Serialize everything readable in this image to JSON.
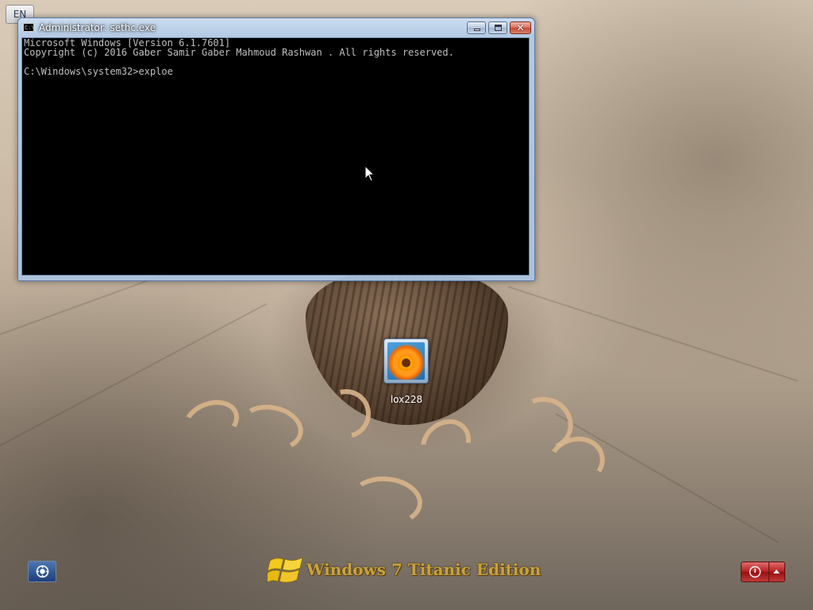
{
  "language_indicator": {
    "label": "EN"
  },
  "console_window": {
    "title": "Administrator: sethc.exe",
    "lines": [
      "Microsoft Windows [Version 6.1.7601]",
      "Copyright (c) 2016 Gaber Samir Gaber Mahmoud Rashwan . All rights reserved.",
      "",
      "C:\\Windows\\system32>exploe"
    ],
    "close_glyph": "✕"
  },
  "user": {
    "name": "lox228"
  },
  "branding": {
    "text": "Windows 7 Titanic Edition"
  },
  "icons": {
    "console": "cmd-icon",
    "minimize": "minimize-icon",
    "maximize": "maximize-icon",
    "close": "close-icon",
    "cursor": "mouse-cursor-icon",
    "ease_of_access": "ease-of-access-icon",
    "windows_logo": "windows-flag-icon",
    "shutdown": "power-icon",
    "shutdown_options": "arrow-up-icon"
  },
  "colors": {
    "console_background": "#000000",
    "console_text": "#c0c0c0",
    "shutdown": "#b41e1e",
    "branding_text": "#c9a23a"
  }
}
